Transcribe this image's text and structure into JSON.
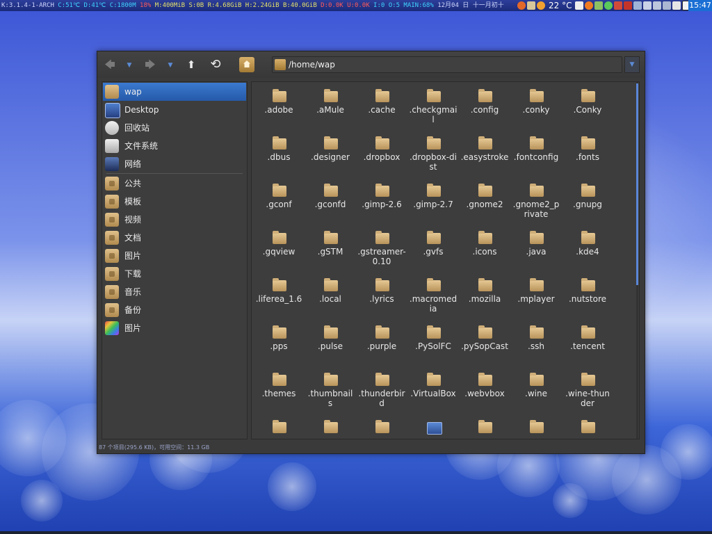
{
  "topbar": {
    "stats": [
      {
        "t": "K:3.1.4-1-ARCH ",
        "c": "w"
      },
      {
        "t": "C:51℃ ",
        "c": "c"
      },
      {
        "t": "D:41℃ ",
        "c": "c"
      },
      {
        "t": "C:1800M ",
        "c": "c"
      },
      {
        "t": "18% ",
        "c": "r"
      },
      {
        "t": "M:400MiB ",
        "c": "y"
      },
      {
        "t": "S:0B ",
        "c": "y"
      },
      {
        "t": "R:4.68GiB ",
        "c": "y"
      },
      {
        "t": "H:2.24GiB ",
        "c": "y"
      },
      {
        "t": "B:40.0GiB ",
        "c": "y"
      },
      {
        "t": "D:0.0K ",
        "c": "r"
      },
      {
        "t": "U:0.0K ",
        "c": "r"
      },
      {
        "t": "I:0 ",
        "c": "c"
      },
      {
        "t": "O:5 ",
        "c": "c"
      },
      {
        "t": "MAIN:68% ",
        "c": "c"
      },
      {
        "t": "12月04 日 十一月初十",
        "c": "w"
      }
    ],
    "temperature": "22 °C",
    "clock": "15:47"
  },
  "toolbar": {
    "back_label": "🡄",
    "forward_label": "🡆",
    "up_label": "⬆",
    "reload_label": "⟲",
    "dropdown_arrow": "▼",
    "path": "/home/wap"
  },
  "sidebar": {
    "items": [
      {
        "label": "wap",
        "icon": "home-folder-icon",
        "selected": true
      },
      {
        "label": "Desktop",
        "icon": "desktop-icon"
      },
      {
        "label": "回收站",
        "icon": "trash-icon"
      },
      {
        "label": "文件系统",
        "icon": "drive-icon"
      },
      {
        "label": "网络",
        "icon": "network-icon"
      },
      {
        "label": "公共",
        "icon": "folder-icon"
      },
      {
        "label": "模板",
        "icon": "folder-icon"
      },
      {
        "label": "视频",
        "icon": "folder-icon"
      },
      {
        "label": "文档",
        "icon": "folder-icon"
      },
      {
        "label": "图片",
        "icon": "folder-icon"
      },
      {
        "label": "下载",
        "icon": "folder-icon"
      },
      {
        "label": "音乐",
        "icon": "folder-icon"
      },
      {
        "label": "备份",
        "icon": "folder-icon"
      },
      {
        "label": "图片",
        "icon": "picture-app-icon"
      }
    ]
  },
  "files": [
    ".adobe",
    ".aMule",
    ".cache",
    ".checkgmail",
    ".config",
    ".conky",
    ".Conky",
    ".dbus",
    ".designer",
    ".dropbox",
    ".dropbox-dist",
    ".easystroke",
    ".fontconfig",
    ".fonts",
    ".gconf",
    ".gconfd",
    ".gimp-2.6",
    ".gimp-2.7",
    ".gnome2",
    ".gnome2_private",
    ".gnupg",
    ".gqview",
    ".gSTM",
    ".gstreamer-0.10",
    ".gvfs",
    ".icons",
    ".java",
    ".kde4",
    ".liferea_1.6",
    ".local",
    ".lyrics",
    ".macromedia",
    ".mozilla",
    ".mplayer",
    ".nutstore",
    ".pps",
    ".pulse",
    ".purple",
    ".PySolFC",
    ".pySopCast",
    ".ssh",
    ".tencent",
    ".themes",
    ".thumbnails",
    ".thunderbird",
    ".VirtualBox",
    ".webvbox",
    ".wine",
    ".wine-thunder",
    "",
    "",
    "",
    "",
    "",
    "",
    ""
  ],
  "status": "87 个项目(295.6 KB)，可用空间：11.3 GB"
}
